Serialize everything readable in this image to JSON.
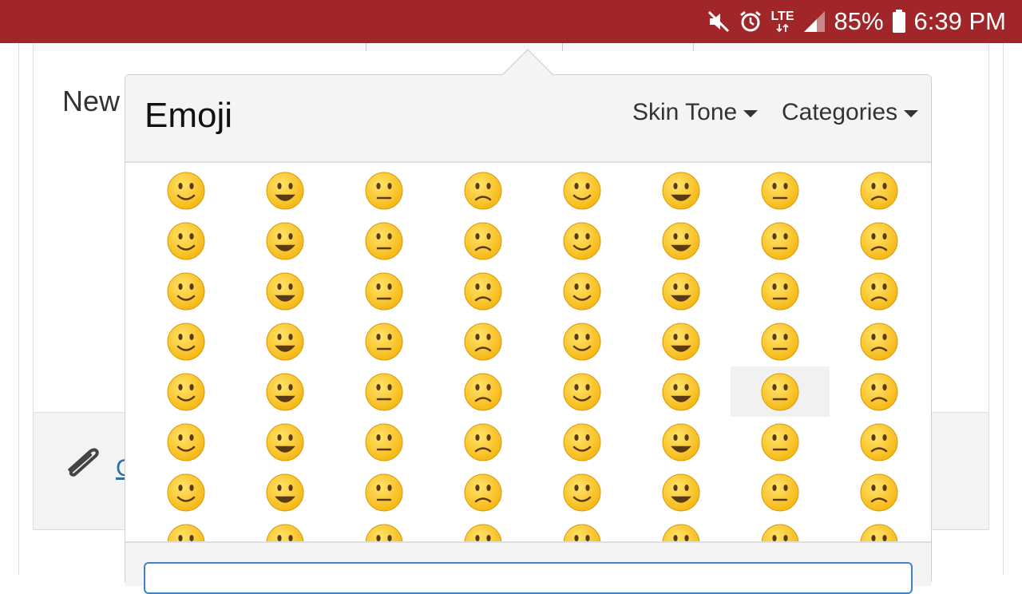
{
  "status_bar": {
    "battery_text": "85%",
    "time": "6:39 PM",
    "network_text": "LTE",
    "icons": [
      "mute-icon",
      "alarm-icon",
      "lte-icon",
      "signal-icon",
      "battery-icon"
    ],
    "background_color": "#a0262a"
  },
  "page": {
    "new_label": "New",
    "attach_link_text": "C"
  },
  "popover": {
    "title": "Emoji",
    "skin_tone_label": "Skin Tone",
    "categories_label": "Categories",
    "search_value": "",
    "selected_index": 38,
    "emojis": [
      "😀",
      "😁",
      "😂",
      "🤣",
      "😃",
      "😄",
      "😅",
      "😆",
      "😉",
      "😊",
      "😋",
      "😎",
      "😍",
      "😘",
      "😗",
      "😙",
      "😚",
      "☺️",
      "🙂",
      "🤗",
      "🤩",
      "🤔",
      "🤨",
      "😐",
      "😑",
      "😶",
      "🙄",
      "😏",
      "😣",
      "😥",
      "😮",
      "🤐",
      "😯",
      "😪",
      "😫",
      "😴",
      "😌",
      "😛",
      "😜",
      "😝",
      "🤤",
      "😒",
      "😓",
      "😔",
      "😕",
      "🙃",
      "🤑",
      "😲",
      "☹️",
      "🙁",
      "😖",
      "😞",
      "😟",
      "😤",
      "😢",
      "😭",
      "😦",
      "😧",
      "😨",
      "😩",
      "🤯",
      "😬",
      "😰",
      "😱"
    ],
    "accent_color": "#3f84c9"
  }
}
